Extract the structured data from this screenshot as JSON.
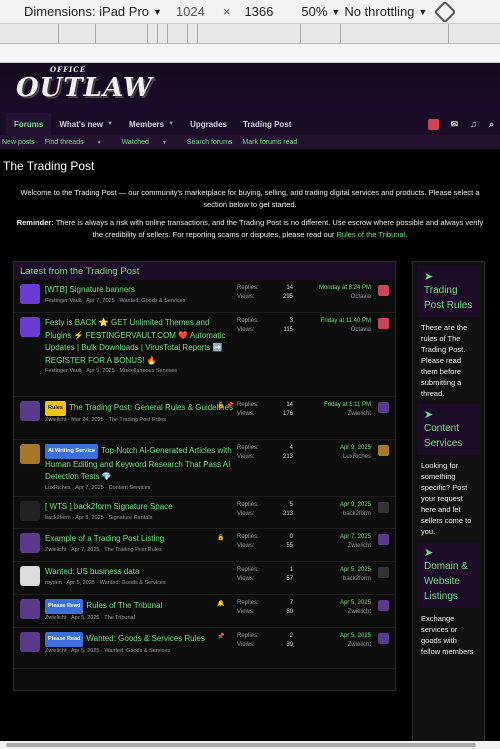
{
  "devtools": {
    "dimensions_label": "Dimensions: iPad Pro",
    "width": "1024",
    "x": "×",
    "height": "1366",
    "zoom": "50%",
    "throttle": "No throttling"
  },
  "brand": {
    "top": "OFFICE",
    "main": "OUTLAW"
  },
  "nav": {
    "items": [
      {
        "label": "Forums",
        "caret": false
      },
      {
        "label": "What's new",
        "caret": true
      },
      {
        "label": "Members",
        "caret": true
      },
      {
        "label": "Upgrades",
        "caret": false
      },
      {
        "label": "Trading Post",
        "caret": false
      }
    ]
  },
  "subnav": {
    "items": [
      "New posts",
      "Find threads",
      "Watched",
      "Search forums",
      "Mark forums read"
    ]
  },
  "page": {
    "title": "The Trading Post",
    "welcome": "Welcome to the Trading Post — our community's marketplace for buying, selling, and trading digital services and products. Please select a section below to get started.",
    "reminder_label": "Reminder:",
    "reminder_text": " There is always a risk with online transactions, and the Trading Post is no different. Use escrow where possible and always verify the credibility of sellers. For reporting scams or disputes, please read our ",
    "reminder_link": "Rules of the Tribunal",
    "reminder_end": "."
  },
  "latest": {
    "title": "Latest from the Trading Post",
    "replies_label": "Replies:",
    "views_label": "Views:",
    "threads": [
      {
        "prefix": "",
        "title": "[WTB] Signature banners",
        "author": "Festinger Vault",
        "date": "Apr 7, 2025",
        "forum": "Wanted: Goods & Services",
        "replies": "14",
        "views": "295",
        "last_date": "Monday at 8:24 PM",
        "last_user": "Octavia",
        "av": "#6a3bd0",
        "av2": "#c45"
      },
      {
        "prefix": "",
        "title": "Festy is BACK ⭐ GET Unlimited Themes and Plugins ⚡ FESTINGERVAULT.COM ❤️ Automatic Updates | Bulk Downloads | VirusTotal Reports ➡️ REGISTER FOR A BONUS! 🔥",
        "author": "Festinger Vault",
        "date": "Apr 9, 2025",
        "forum": "Miscellaneous Services",
        "replies": "3",
        "views": "115",
        "last_date": "Friday at 11:40 PM",
        "last_user": "Octavia",
        "av": "#6a3bd0",
        "av2": "#c45"
      },
      {
        "prefix": "Rules",
        "title": "The Trading Post: General Rules & Guidelines",
        "author": "Zwielicht",
        "date": "Mar 24, 2025",
        "forum": "The Trading Post Rules",
        "replies": "14",
        "views": "176",
        "last_date": "Friday at 1:11 PM",
        "last_user": "Zwielicht",
        "av": "#5a3a8a",
        "av2": "#5a3a8a"
      },
      {
        "prefix": "AI Writing Service",
        "title": "Top-Notch AI-Generated Articles with Human Editing and Keyword Research That Pass AI Detection Tests 💎",
        "author": "LuxRiches",
        "date": "Apr 7, 2025",
        "forum": "Content Services",
        "replies": "4",
        "views": "213",
        "last_date": "Apr 9, 2025",
        "last_user": "LuxRiches",
        "av": "#a8782a",
        "av2": "#a8782a"
      },
      {
        "prefix": "",
        "title": "[ WTS ] back2form Signature Space",
        "author": "back2form",
        "date": "Apr 8, 2025",
        "forum": "Signature Rentals",
        "replies": "5",
        "views": "213",
        "last_date": "Apr 9, 2025",
        "last_user": "back2form",
        "av": "#222",
        "av2": "#333"
      },
      {
        "prefix": "",
        "title": "Example of a Trading Post Listing",
        "author": "Zwielicht",
        "date": "Apr 7, 2025",
        "forum": "The Trading Post Rules",
        "replies": "0",
        "views": "55",
        "last_date": "Apr 7, 2025",
        "last_user": "Zwielicht",
        "av": "#5a3a8a",
        "av2": "#5a3a8a"
      },
      {
        "prefix": "",
        "title": "Wanted: US business data",
        "author": "royden",
        "date": "Apr 5, 2025",
        "forum": "Wanted: Goods & Services",
        "replies": "1",
        "views": "57",
        "last_date": "Apr 5, 2025",
        "last_user": "back2form",
        "av": "#ddd",
        "av2": "#333"
      },
      {
        "prefix": "Please Read",
        "title": "Rules of The Tribunal",
        "author": "Zwielicht",
        "date": "Apr 5, 2025",
        "forum": "The Tribunal",
        "replies": "7",
        "views": "80",
        "last_date": "Apr 5, 2025",
        "last_user": "Zwielicht",
        "av": "#5a3a8a",
        "av2": "#5a3a8a"
      },
      {
        "prefix": "Please Read",
        "title": "Wanted: Goods & Services Rules",
        "author": "Zwielicht",
        "date": "Apr 5, 2025",
        "forum": "Wanted: Goods & Services",
        "replies": "2",
        "views": "39",
        "last_date": "Apr 5, 2025",
        "last_user": "Zwielicht",
        "av": "#5a3a8a",
        "av2": "#5a3a8a"
      }
    ]
  },
  "sidebar": {
    "blocks": [
      {
        "title": "Trading Post Rules",
        "desc": "These are the rules of The Trading Post. Please read them before submitting a thread."
      },
      {
        "title": "Content Services",
        "desc": "Looking for something specific? Post your request here and let sellers come to you."
      },
      {
        "title": "Domain & Website Listings",
        "desc": "Exchange services or goods with fellow members"
      }
    ]
  }
}
